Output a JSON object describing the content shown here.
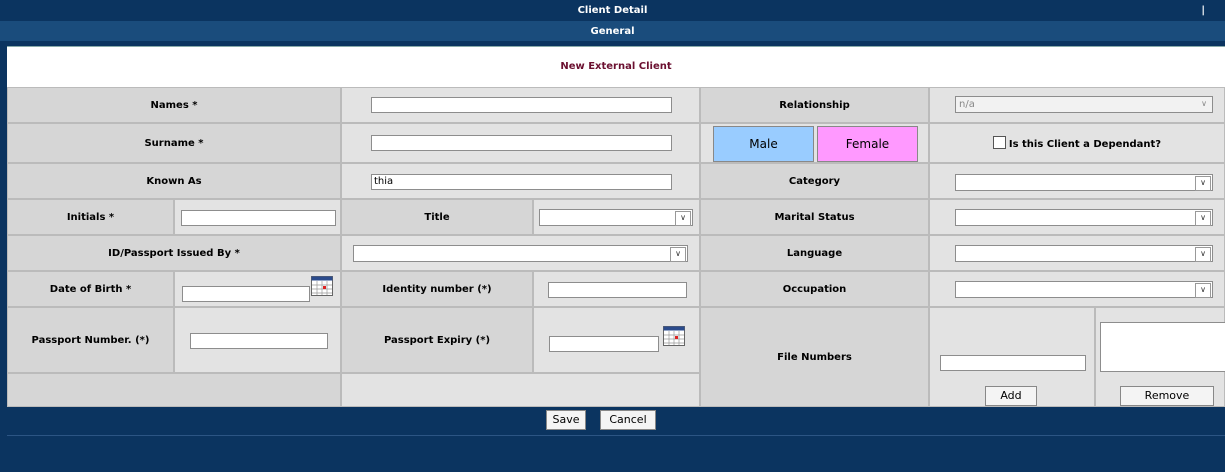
{
  "header": {
    "title": "Client Detail",
    "pipe": "|",
    "section": "General"
  },
  "form": {
    "heading": "New External Client",
    "names_label": "Names *",
    "surname_label": "Surname *",
    "known_as_label": "Known As",
    "known_as_value": "thia",
    "initials_label": "Initials *",
    "title_label": "Title",
    "id_issued_label": "ID/Passport Issued By *",
    "dob_label": "Date of Birth *",
    "identity_label": "Identity number (*)",
    "passport_label": "Passport Number. (*)",
    "passport_expiry_label": "Passport Expiry (*)",
    "relationship_label": "Relationship",
    "relationship_value": "n/a",
    "male_label": "Male",
    "female_label": "Female",
    "dependant_label": "Is this Client a Dependant?",
    "category_label": "Category",
    "marital_label": "Marital Status",
    "language_label": "Language",
    "occupation_label": "Occupation",
    "file_numbers_label": "File Numbers",
    "add_label": "Add",
    "remove_label": "Remove"
  },
  "actions": {
    "save": "Save",
    "cancel": "Cancel"
  },
  "colors": {
    "navy": "#0b3460",
    "male": "#99ccff",
    "female": "#ff99ff",
    "heading": "#6b1030"
  },
  "icons": {
    "calendar": "calendar-icon",
    "dropdown": "chevron-down-icon"
  }
}
